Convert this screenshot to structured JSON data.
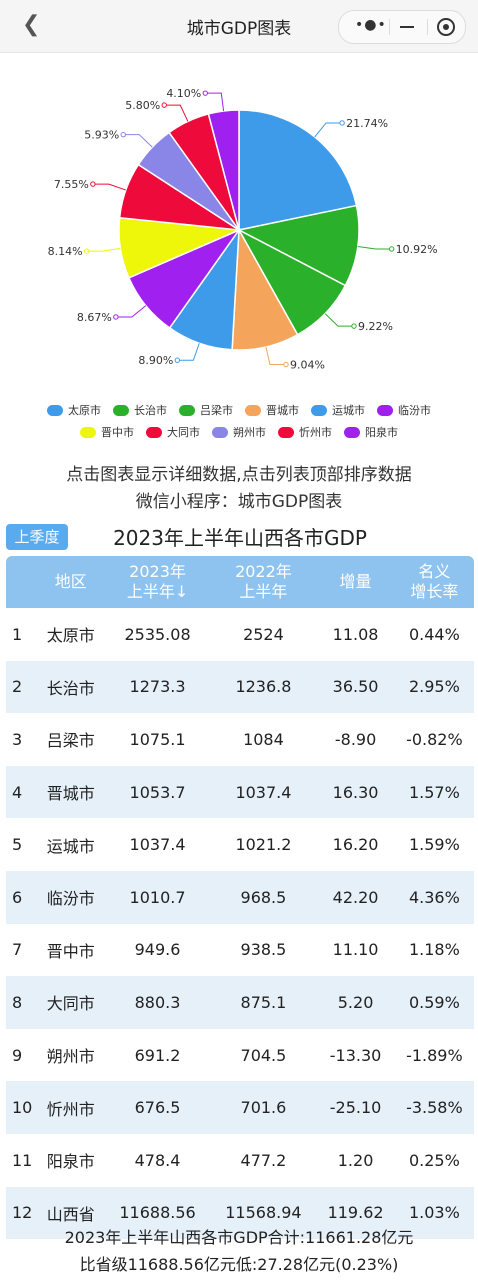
{
  "header": {
    "title": "城市GDP图表",
    "back_icon": "chevron-left-icon"
  },
  "chart_data": {
    "type": "pie",
    "title": "",
    "labels": [
      "太原市",
      "长治市",
      "吕梁市",
      "晋城市",
      "运城市",
      "临汾市",
      "晋中市",
      "大同市",
      "朔州市",
      "忻州市",
      "阳泉市"
    ],
    "values": [
      21.74,
      10.92,
      9.22,
      9.04,
      8.9,
      8.67,
      8.14,
      7.55,
      5.93,
      5.8,
      4.1
    ],
    "value_labels": [
      "21.74%",
      "10.92%",
      "9.22%",
      "9.04%",
      "8.90%",
      "8.67%",
      "8.14%",
      "7.55%",
      "5.93%",
      "5.80%",
      "4.10%"
    ],
    "colors": [
      "#3d9be9",
      "#2ab02a",
      "#2ab02a",
      "#f5a45c",
      "#3d9be9",
      "#a020f0",
      "#eef70a",
      "#ee0a3a",
      "#8a86e8",
      "#ee0a3a",
      "#a020f0"
    ],
    "legend_placement": "bottom"
  },
  "notice": {
    "line1": "点击图表显示详细数据,点击列表顶部排序数据",
    "line2": "微信小程序：城市GDP图表"
  },
  "quarter_button": "上季度",
  "heading": "2023年上半年山西各市GDP",
  "table": {
    "headers": [
      "",
      "地区",
      "2023年\n上半年↓",
      "2022年\n上半年",
      "增量",
      "名义\n增长率"
    ],
    "rows": [
      [
        "1",
        "太原市",
        "2535.08",
        "2524",
        "11.08",
        "0.44%"
      ],
      [
        "2",
        "长治市",
        "1273.3",
        "1236.8",
        "36.50",
        "2.95%"
      ],
      [
        "3",
        "吕梁市",
        "1075.1",
        "1084",
        "-8.90",
        "-0.82%"
      ],
      [
        "4",
        "晋城市",
        "1053.7",
        "1037.4",
        "16.30",
        "1.57%"
      ],
      [
        "5",
        "运城市",
        "1037.4",
        "1021.2",
        "16.20",
        "1.59%"
      ],
      [
        "6",
        "临汾市",
        "1010.7",
        "968.5",
        "42.20",
        "4.36%"
      ],
      [
        "7",
        "晋中市",
        "949.6",
        "938.5",
        "11.10",
        "1.18%"
      ],
      [
        "8",
        "大同市",
        "880.3",
        "875.1",
        "5.20",
        "0.59%"
      ],
      [
        "9",
        "朔州市",
        "691.2",
        "704.5",
        "-13.30",
        "-1.89%"
      ],
      [
        "10",
        "忻州市",
        "676.5",
        "701.6",
        "-25.10",
        "-3.58%"
      ],
      [
        "11",
        "阳泉市",
        "478.4",
        "477.2",
        "1.20",
        "0.25%"
      ],
      [
        "12",
        "山西省",
        "11688.56",
        "11568.94",
        "119.62",
        "1.03%"
      ]
    ]
  },
  "summary": {
    "line1": "2023年上半年山西各市GDP合计:11661.28亿元",
    "line2": "比省级11688.56亿元低:27.28亿元(0.23%)"
  }
}
